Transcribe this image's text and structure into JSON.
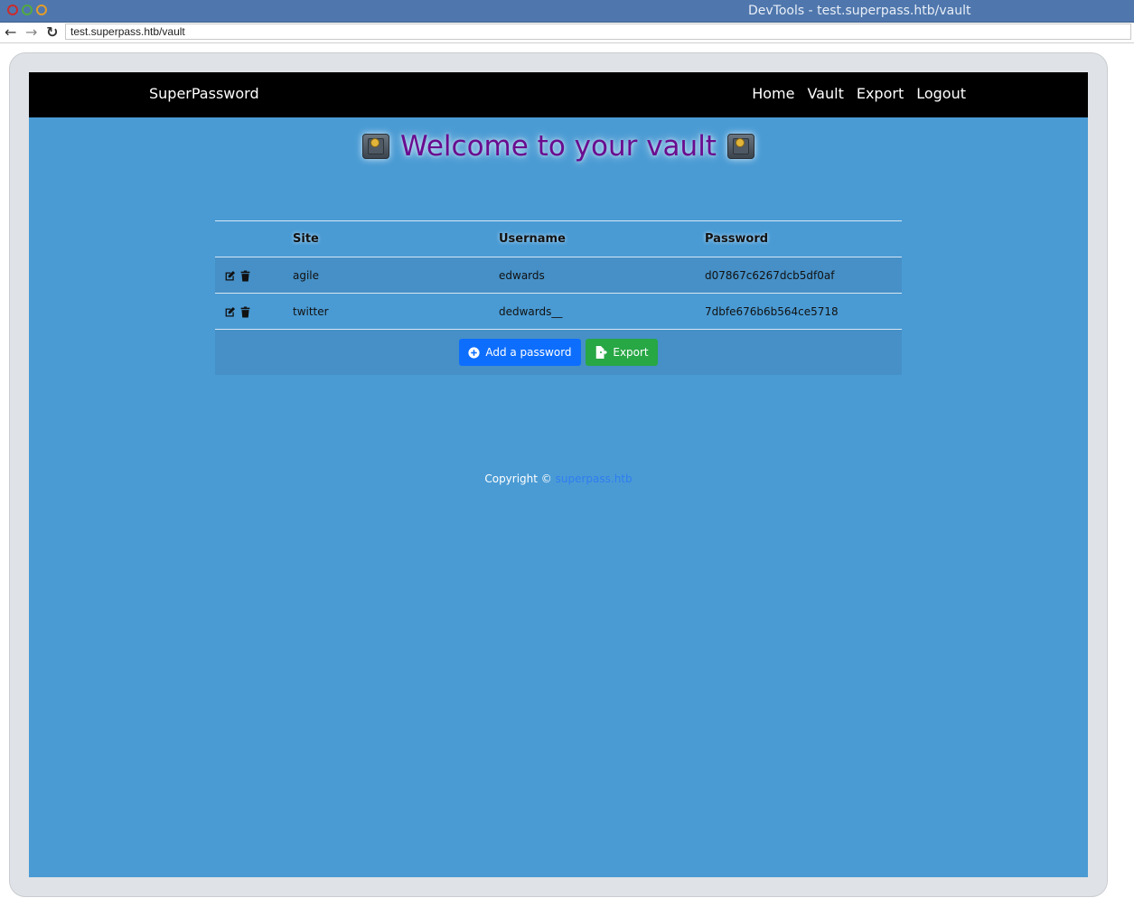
{
  "window": {
    "title": "DevTools - test.superpass.htb/vault"
  },
  "browser": {
    "url": "test.superpass.htb/vault"
  },
  "navbar": {
    "brand": "SuperPassword",
    "links": [
      "Home",
      "Vault",
      "Export",
      "Logout"
    ]
  },
  "page": {
    "heading": "Welcome to your vault"
  },
  "table": {
    "headers": [
      "Site",
      "Username",
      "Password"
    ],
    "rows": [
      {
        "site": "agile",
        "username": "edwards",
        "password": "d07867c6267dcb5df0af"
      },
      {
        "site": "twitter",
        "username": "dedwards__",
        "password": "7dbfe676b6b564ce5718"
      }
    ]
  },
  "buttons": {
    "add": "Add a password",
    "export": "Export"
  },
  "footer": {
    "copyright": "Copyright ©",
    "link": "superpass.htb"
  },
  "colors": {
    "background": "#4a9bd4",
    "navbar": "#000000",
    "heading": "#6a0c8f",
    "add_button": "#0d6efd",
    "export_button": "#28a745",
    "footer_link": "#2f7df0"
  },
  "icons": {
    "row_actions": [
      "edit-icon",
      "trash-icon"
    ],
    "add_button": "plus-circle-icon",
    "export_button": "file-export-icon",
    "heading": "safe-icon"
  }
}
